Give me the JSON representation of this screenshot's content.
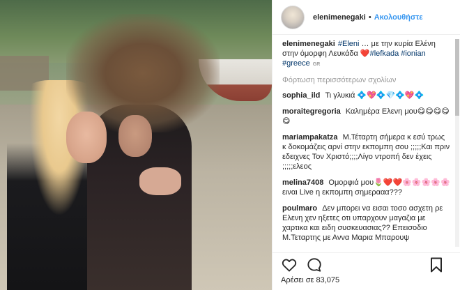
{
  "header": {
    "username": "elenimenegaki",
    "separator": "•",
    "follow_label": "Ακολουθήστε"
  },
  "caption": {
    "user": "elenimenegaki",
    "hashtag_eleni": "#Eleni",
    "text_1": "… με την κυρία Ελένη στην όμορφη Λευκάδα",
    "heart": "❤️",
    "hashtag_lefkada": "#lefkada",
    "hashtag_ionian": "#ionian",
    "hashtag_greece": "#greece",
    "lang": "GR"
  },
  "load_more_label": "Φόρτωση περισσότερων σχολίων",
  "comments": [
    {
      "user": "sophia_ild",
      "text": "Τι γλυκιά 💠💖💠💎💠💖💠"
    },
    {
      "user": "moraitegregoria",
      "text": "Καλημέρα Ελενη μου😋😋😋😋😋"
    },
    {
      "user": "mariampakatza",
      "text": "Μ.Τέταρτη σήμερα κ εσύ τρως κ δοκομάζεις αρνί στην εκπομπη σου ;;;;;Και πριν εδειχνες Τον Χριστό;;;;Λίγο ντροπή δεν έχεις ;;;;;ελεος"
    },
    {
      "user": "melina7408",
      "text": "Ομορφιά μου🌷❤️❤️🌸🌸🌸🌸🌸 ειναι Live η εκπομπη σημερααα???"
    },
    {
      "user": "poulmaro",
      "text": "Δεν μπορει να εισαι τοσο ασχετη ρε Ελενη χεν ηξετες οτι υπαρχουν μαγαζια με χαρτικα και ειδη συσκευασιας?? Επεισοδιο Μ.Τεταρτης με Αννα Μαρια Μπαρουψ"
    }
  ],
  "likes_text": "Αρέσει σε 83,075",
  "icons": {
    "like": "heart-icon",
    "comment": "comment-bubble-icon",
    "save": "bookmark-icon"
  },
  "colors": {
    "link": "#3897f0",
    "hashtag": "#003569",
    "text": "#262626",
    "muted": "#999999"
  }
}
